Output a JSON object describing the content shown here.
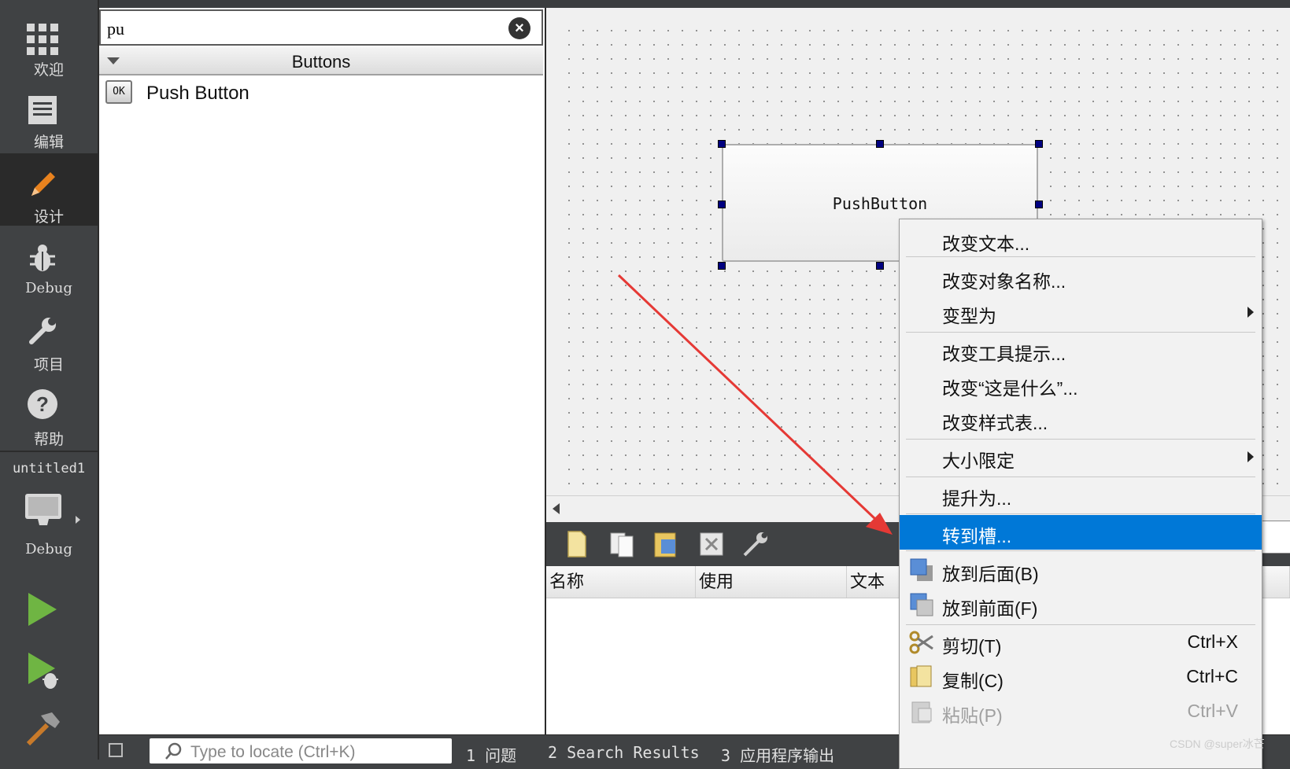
{
  "modes": [
    {
      "name": "welcome",
      "label": "欢迎",
      "icon": "grid-icon"
    },
    {
      "name": "edit",
      "label": "编辑",
      "icon": "document-icon"
    },
    {
      "name": "design",
      "label": "设计",
      "icon": "pencil-icon"
    },
    {
      "name": "debug",
      "label": "Debug",
      "icon": "bug-icon"
    },
    {
      "name": "projects",
      "label": "项目",
      "icon": "wrench-icon"
    },
    {
      "name": "help",
      "label": "帮助",
      "icon": "help-icon"
    }
  ],
  "project": {
    "name": "untitled1",
    "build_label": "Debug"
  },
  "widget_box": {
    "filter_value": "pu",
    "category": "Buttons",
    "items": [
      {
        "label": "Push Button",
        "icon_text": "OK"
      }
    ]
  },
  "form": {
    "button_text": "PushButton"
  },
  "action_editor": {
    "columns": [
      "名称",
      "使用",
      "文本"
    ]
  },
  "context_menu": {
    "items": [
      {
        "label": "改变文本..."
      },
      {
        "label": "改变对象名称..."
      },
      {
        "label": "变型为",
        "submenu": true
      },
      {
        "label": "改变工具提示..."
      },
      {
        "label": "改变“这是什么”..."
      },
      {
        "label": "改变样式表..."
      },
      {
        "label": "大小限定",
        "submenu": true
      },
      {
        "label": "提升为..."
      },
      {
        "label": "转到槽...",
        "highlighted": true
      },
      {
        "label": "放到后面(B)"
      },
      {
        "label": "放到前面(F)"
      },
      {
        "label": "剪切(T)",
        "shortcut": "Ctrl+X"
      },
      {
        "label": "复制(C)",
        "shortcut": "Ctrl+C"
      },
      {
        "label": "粘贴(P)",
        "shortcut": "Ctrl+V",
        "disabled": true
      }
    ]
  },
  "bottom": {
    "locator_placeholder": "Type to locate (Ctrl+K)",
    "tabs": [
      "1 问题",
      "2 Search Results",
      "3 应用程序输出"
    ]
  },
  "watermark": "CSDN @super冰芒",
  "colors": {
    "highlight": "#0078d7",
    "handle": "#000080",
    "arrow": "#e53935"
  }
}
